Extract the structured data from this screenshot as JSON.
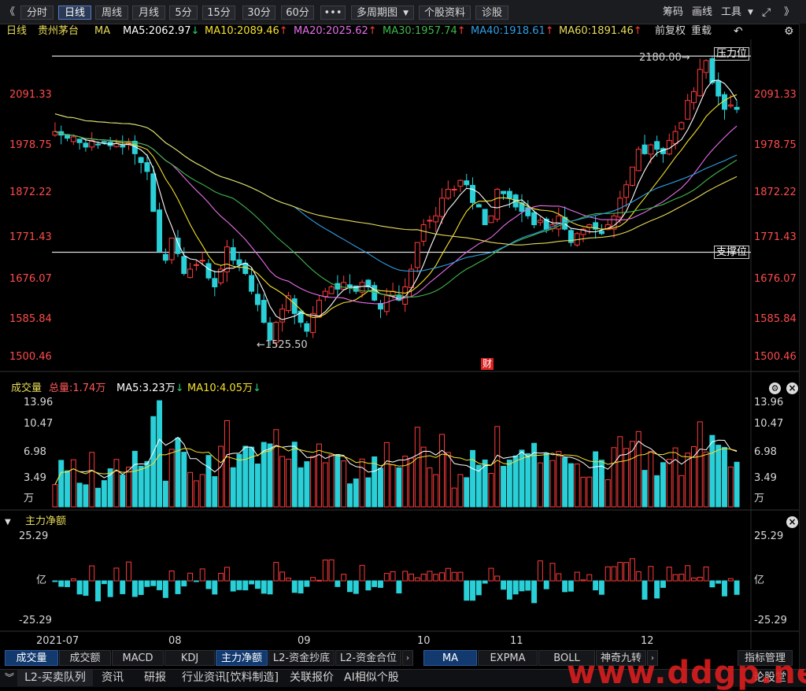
{
  "toolbar": {
    "back": "《",
    "periods": [
      "分时",
      "日线",
      "周线",
      "月线",
      "5分",
      "15分",
      "30分",
      "60分"
    ],
    "active_period": "日线",
    "more": "•••",
    "multi": "多周期图",
    "stock_info": "个股资料",
    "diagnose": "诊股",
    "chips": "筹码",
    "draw": "画线",
    "tools": "工具",
    "forward": "》"
  },
  "legend": {
    "period": "日线",
    "stock": "贵州茅台",
    "ma_label": "MA",
    "ma5": "MA5:2062.97",
    "ma10": "MA10:2089.46",
    "ma20": "MA20:2025.62",
    "ma30": "MA30:1957.74",
    "ma40": "MA40:1918.61",
    "ma60": "MA60:1891.46",
    "adjust": "前复权",
    "stack": "重载",
    "colors": {
      "ma5": "#ffffff",
      "ma10": "#f5e12c",
      "ma20": "#e86ee8",
      "ma30": "#3fb84a",
      "ma40": "#2f9fe6",
      "ma60": "#e8dc5a",
      "up": "#ff3b3b",
      "down": "#2ad0d8"
    }
  },
  "price_panel": {
    "y_ticks": [
      "2091.33",
      "1978.75",
      "1872.22",
      "1771.43",
      "1676.07",
      "1585.84",
      "1500.46"
    ],
    "high_marker": "2180.00→",
    "low_marker": "←1525.50",
    "resistance_label": "压力位",
    "support_label": "支撑位",
    "finance_badge": "财"
  },
  "volume_panel": {
    "title": "成交量",
    "total": "总量:1.74万",
    "ma5": "MA5:3.23万",
    "ma10": "MA10:4.05万",
    "y_ticks": [
      "13.96",
      "10.47",
      "6.98",
      "3.49",
      "万"
    ]
  },
  "flow_panel": {
    "title": "主力净额",
    "y_ticks": [
      "25.29",
      "亿",
      "-25.29"
    ]
  },
  "x_axis": [
    "2021-07",
    "08",
    "09",
    "10",
    "11",
    "12"
  ],
  "indicator_tabs": [
    "成交量",
    "成交额",
    "MACD",
    "KDJ",
    "主力净额",
    "L2-资金抄底",
    "L2-资金合位"
  ],
  "overlay_tabs": [
    "MA",
    "EXPMA",
    "BOLL",
    "神奇九转"
  ],
  "indicator_manage": "指标管理",
  "status_tabs": [
    "L2-买卖队列",
    "资讯",
    "研报",
    "行业资讯[饮料制造]",
    "关联报价",
    "AI相似个股"
  ],
  "status_right": "论股堂",
  "watermark": "www.ddgp.net",
  "chart_data": {
    "type": "candlestick",
    "close": [
      2010,
      2002,
      1995,
      1998,
      1985,
      1975,
      1990,
      1980,
      1985,
      1978,
      1983,
      1975,
      1985,
      1960,
      1940,
      1920,
      1830,
      1740,
      1720,
      1770,
      1735,
      1690,
      1700,
      1710,
      1720,
      1680,
      1660,
      1700,
      1750,
      1720,
      1710,
      1690,
      1650,
      1620,
      1580,
      1540,
      1580,
      1610,
      1640,
      1600,
      1580,
      1560,
      1600,
      1630,
      1650,
      1660,
      1655,
      1670,
      1660,
      1650,
      1670,
      1660,
      1630,
      1610,
      1640,
      1650,
      1630,
      1660,
      1700,
      1760,
      1800,
      1810,
      1820,
      1860,
      1880,
      1880,
      1900,
      1890,
      1850,
      1840,
      1800,
      1820,
      1880,
      1870,
      1860,
      1840,
      1830,
      1820,
      1800,
      1810,
      1790,
      1800,
      1820,
      1790,
      1760,
      1780,
      1790,
      1800,
      1790,
      1780,
      1800,
      1820,
      1860,
      1890,
      1930,
      1970,
      1960,
      1980,
      1970,
      1960,
      1990,
      2010,
      2030,
      2080,
      2100,
      2150,
      2170,
      2120,
      2090,
      2060,
      2070,
      2060
    ],
    "volume_scale_max": 13.96,
    "flow_range": [
      -25.29,
      25.29
    ]
  }
}
